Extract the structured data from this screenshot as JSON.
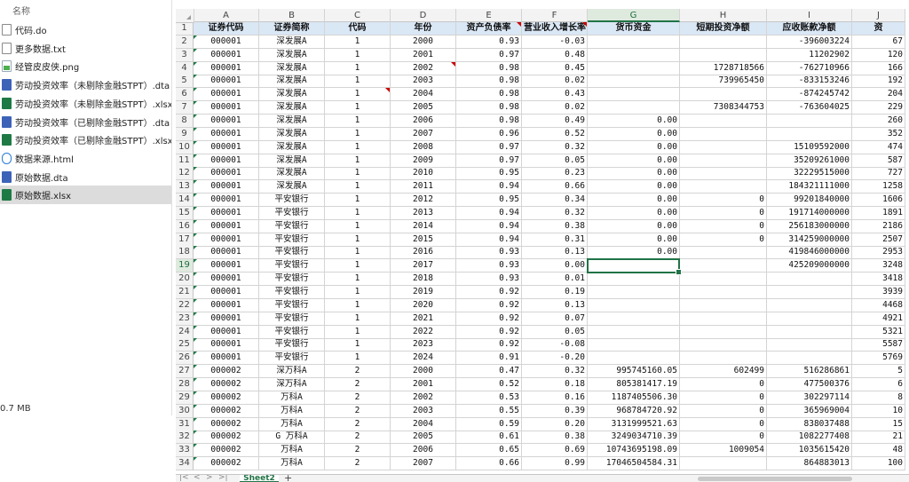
{
  "file_panel": {
    "header_label": "名称",
    "items": [
      {
        "name": "代码.do",
        "icon": "do-file-icon"
      },
      {
        "name": "更多数据.txt",
        "icon": "txt-file-icon"
      },
      {
        "name": "经管皮皮侠.png",
        "icon": "png-file-icon"
      },
      {
        "name": "劳动投资效率（未剔除金融STPT）.dta",
        "icon": "dta-file-icon"
      },
      {
        "name": "劳动投资效率（未剔除金融STPT）.xlsx",
        "icon": "xlsx-file-icon"
      },
      {
        "name": "劳动投资效率（已剔除金融STPT）.dta",
        "icon": "dta-file-icon"
      },
      {
        "name": "劳动投资效率（已剔除金融STPT）.xlsx",
        "icon": "xlsx-file-icon"
      },
      {
        "name": "数据来源.html",
        "icon": "html-file-icon"
      },
      {
        "name": "原始数据.dta",
        "icon": "dta-file-icon"
      },
      {
        "name": "原始数据.xlsx",
        "icon": "xlsx-file-icon",
        "selected": true
      }
    ],
    "size_text": "0.7 MB"
  },
  "sheet": {
    "col_letters": [
      "A",
      "B",
      "C",
      "D",
      "E",
      "F",
      "G",
      "H",
      "I",
      "J"
    ],
    "active_col": "G",
    "active_row": 19,
    "headers": [
      "证券代码",
      "证券简称",
      "代码",
      "年份",
      "资产负债率",
      "营业收入增长率",
      "货币资金",
      "短期投资净额",
      "应收账款净额",
      "资"
    ],
    "rows": [
      [
        "000001",
        "深发展A",
        "1",
        "2000",
        "0.93",
        "-0.03",
        "",
        "",
        "-396003224",
        "67"
      ],
      [
        "000001",
        "深发展A",
        "1",
        "2001",
        "0.97",
        "0.48",
        "",
        "",
        "11202902",
        "120"
      ],
      [
        "000001",
        "深发展A",
        "1",
        "2002",
        "0.98",
        "0.45",
        "",
        "1728718566",
        "-762710966",
        "166"
      ],
      [
        "000001",
        "深发展A",
        "1",
        "2003",
        "0.98",
        "0.02",
        "",
        "739965450",
        "-833153246",
        "192"
      ],
      [
        "000001",
        "深发展A",
        "1",
        "2004",
        "0.98",
        "0.43",
        "",
        "",
        "-874245742",
        "204"
      ],
      [
        "000001",
        "深发展A",
        "1",
        "2005",
        "0.98",
        "0.02",
        "",
        "7308344753",
        "-763604025",
        "229"
      ],
      [
        "000001",
        "深发展A",
        "1",
        "2006",
        "0.98",
        "0.49",
        "0.00",
        "",
        "",
        "260"
      ],
      [
        "000001",
        "深发展A",
        "1",
        "2007",
        "0.96",
        "0.52",
        "0.00",
        "",
        "",
        "352"
      ],
      [
        "000001",
        "深发展A",
        "1",
        "2008",
        "0.97",
        "0.32",
        "0.00",
        "",
        "15109592000",
        "474"
      ],
      [
        "000001",
        "深发展A",
        "1",
        "2009",
        "0.97",
        "0.05",
        "0.00",
        "",
        "35209261000",
        "587"
      ],
      [
        "000001",
        "深发展A",
        "1",
        "2010",
        "0.95",
        "0.23",
        "0.00",
        "",
        "32229515000",
        "727"
      ],
      [
        "000001",
        "深发展A",
        "1",
        "2011",
        "0.94",
        "0.66",
        "0.00",
        "",
        "184321111000",
        "1258"
      ],
      [
        "000001",
        "平安银行",
        "1",
        "2012",
        "0.95",
        "0.34",
        "0.00",
        "0",
        "99201840000",
        "1606"
      ],
      [
        "000001",
        "平安银行",
        "1",
        "2013",
        "0.94",
        "0.32",
        "0.00",
        "0",
        "191714000000",
        "1891"
      ],
      [
        "000001",
        "平安银行",
        "1",
        "2014",
        "0.94",
        "0.38",
        "0.00",
        "0",
        "256183000000",
        "2186"
      ],
      [
        "000001",
        "平安银行",
        "1",
        "2015",
        "0.94",
        "0.31",
        "0.00",
        "0",
        "314259000000",
        "2507"
      ],
      [
        "000001",
        "平安银行",
        "1",
        "2016",
        "0.93",
        "0.13",
        "0.00",
        "",
        "419846000000",
        "2953"
      ],
      [
        "000001",
        "平安银行",
        "1",
        "2017",
        "0.93",
        "0.00",
        "",
        "",
        "425209000000",
        "3248"
      ],
      [
        "000001",
        "平安银行",
        "1",
        "2018",
        "0.93",
        "0.01",
        "",
        "",
        "",
        "3418"
      ],
      [
        "000001",
        "平安银行",
        "1",
        "2019",
        "0.92",
        "0.19",
        "",
        "",
        "",
        "3939"
      ],
      [
        "000001",
        "平安银行",
        "1",
        "2020",
        "0.92",
        "0.13",
        "",
        "",
        "",
        "4468"
      ],
      [
        "000001",
        "平安银行",
        "1",
        "2021",
        "0.92",
        "0.07",
        "",
        "",
        "",
        "4921"
      ],
      [
        "000001",
        "平安银行",
        "1",
        "2022",
        "0.92",
        "0.05",
        "",
        "",
        "",
        "5321"
      ],
      [
        "000001",
        "平安银行",
        "1",
        "2023",
        "0.92",
        "-0.08",
        "",
        "",
        "",
        "5587"
      ],
      [
        "000001",
        "平安银行",
        "1",
        "2024",
        "0.91",
        "-0.20",
        "",
        "",
        "",
        "5769"
      ],
      [
        "000002",
        "深万科A",
        "2",
        "2000",
        "0.47",
        "0.32",
        "995745160.05",
        "602499",
        "516286861",
        "5"
      ],
      [
        "000002",
        "深万科A",
        "2",
        "2001",
        "0.52",
        "0.18",
        "805381417.19",
        "0",
        "477500376",
        "6"
      ],
      [
        "000002",
        "万科A",
        "2",
        "2002",
        "0.53",
        "0.16",
        "1187405506.30",
        "0",
        "302297114",
        "8"
      ],
      [
        "000002",
        "万科A",
        "2",
        "2003",
        "0.55",
        "0.39",
        "968784720.92",
        "0",
        "365969004",
        "10"
      ],
      [
        "000002",
        "万科A",
        "2",
        "2004",
        "0.59",
        "0.20",
        "3131999521.63",
        "0",
        "838037488",
        "15"
      ],
      [
        "000002",
        "G 万科A",
        "2",
        "2005",
        "0.61",
        "0.38",
        "3249034710.39",
        "0",
        "1082277408",
        "21"
      ],
      [
        "000002",
        "万科A",
        "2",
        "2006",
        "0.65",
        "0.69",
        "10743695198.09",
        "1009054",
        "1035615420",
        "48"
      ],
      [
        "000002",
        "万科A",
        "2",
        "2007",
        "0.66",
        "0.99",
        "17046504584.31",
        "",
        "864883013",
        "100"
      ]
    ],
    "sheet_tab": "Sheet2",
    "add_sheet": "+",
    "nav": [
      "|<",
      "<",
      ">",
      ">|"
    ]
  }
}
